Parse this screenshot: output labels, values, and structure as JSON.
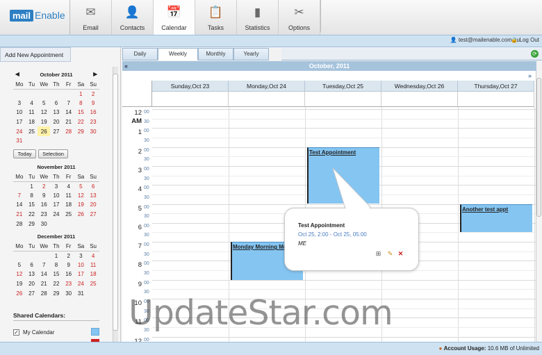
{
  "app": {
    "logo_box": "mail",
    "logo_text": "Enable"
  },
  "tabs": [
    {
      "label": "Email",
      "icon": "email-icon"
    },
    {
      "label": "Contacts",
      "icon": "contacts-icon"
    },
    {
      "label": "Calendar",
      "icon": "calendar-icon",
      "active": true
    },
    {
      "label": "Tasks",
      "icon": "tasks-icon"
    },
    {
      "label": "Statistics",
      "icon": "statistics-icon"
    },
    {
      "label": "Options",
      "icon": "options-icon"
    }
  ],
  "header": {
    "user_email": "test@mailenable.com.au",
    "logout": "Log Out"
  },
  "sidebar": {
    "add_appointment": "Add New Appointment",
    "today_button": "Today",
    "selection_button": "Selection",
    "shared_calendars_title": "Shared Calendars:",
    "my_calendar_label": "My Calendar",
    "my_calendar_checked": "✓",
    "weekdays": [
      "Mo",
      "Tu",
      "We",
      "Th",
      "Fr",
      "Sa",
      "Su"
    ],
    "months": [
      {
        "title": "October 2011",
        "prev": "◀",
        "next": "▶",
        "weeks": [
          [
            "",
            "",
            "",
            "",
            "",
            "1",
            "2"
          ],
          [
            "3",
            "4",
            "5",
            "6",
            "7",
            "8",
            "9"
          ],
          [
            "10",
            "11",
            "12",
            "13",
            "14",
            "15",
            "16"
          ],
          [
            "17",
            "18",
            "19",
            "20",
            "21",
            "22",
            "23"
          ],
          [
            "24",
            "25",
            "26",
            "27",
            "28",
            "29",
            "30"
          ],
          [
            "31",
            "",
            "",
            "",
            "",
            "",
            ""
          ]
        ]
      },
      {
        "title": "November 2011",
        "weeks": [
          [
            "",
            "1",
            "2",
            "3",
            "4",
            "5",
            "6"
          ],
          [
            "7",
            "8",
            "9",
            "10",
            "11",
            "12",
            "13"
          ],
          [
            "14",
            "15",
            "16",
            "17",
            "18",
            "19",
            "20"
          ],
          [
            "21",
            "22",
            "23",
            "24",
            "25",
            "26",
            "27"
          ],
          [
            "28",
            "29",
            "30",
            "",
            "",
            "",
            ""
          ]
        ]
      },
      {
        "title": "December 2011",
        "weeks": [
          [
            "",
            "",
            "",
            "1",
            "2",
            "3",
            "4"
          ],
          [
            "5",
            "6",
            "7",
            "8",
            "9",
            "10",
            "11"
          ],
          [
            "12",
            "13",
            "14",
            "15",
            "16",
            "17",
            "18"
          ],
          [
            "19",
            "20",
            "21",
            "22",
            "23",
            "24",
            "25"
          ],
          [
            "26",
            "27",
            "28",
            "29",
            "30",
            "31",
            ""
          ]
        ]
      }
    ],
    "colors": {
      "my_calendar": "#85c5f2",
      "second_calendar": "#d02020"
    }
  },
  "views": {
    "daily": "Daily",
    "weekly": "Weekly",
    "monthly": "Monthly",
    "yearly": "Yearly",
    "active": "Weekly"
  },
  "calendar": {
    "month_title": "October, 2011",
    "prev": "«",
    "next": "»",
    "days": [
      "Sunday,Oct 23",
      "Monday,Oct 24",
      "Tuesday,Oct 25",
      "Wednesday,Oct 26",
      "Thursday,Oct 27"
    ],
    "hours": [
      "12 AM",
      "1",
      "2",
      "3",
      "4",
      "5",
      "6",
      "7",
      "8",
      "9",
      "10",
      "11",
      "12"
    ],
    "minute_labels": [
      "00",
      "30"
    ],
    "appointments": [
      {
        "title": "Test Appointment",
        "day": "Tuesday,Oct 25",
        "start": "02:00",
        "end": "05:00"
      },
      {
        "title": "Monday Morning Me",
        "day": "Monday,Oct 24",
        "start": "07:00",
        "end": "09:00"
      },
      {
        "title": "Another test appt",
        "day": "Thursday,Oct 27",
        "start": "05:00",
        "end": "06:30"
      }
    ]
  },
  "popup": {
    "title": "Test Appointment",
    "time": "Oct 25, 2:00 - Oct 25, 05:00",
    "owner": "ME"
  },
  "footer": {
    "usage_label": "Account Usage:",
    "usage_value": "10.6 MB of Unlimited"
  },
  "watermark": "UpdateStar.com",
  "colors": {
    "accent": "#2d7fc3",
    "appointment": "#85c5f2",
    "bar": "#cfe2f1"
  }
}
